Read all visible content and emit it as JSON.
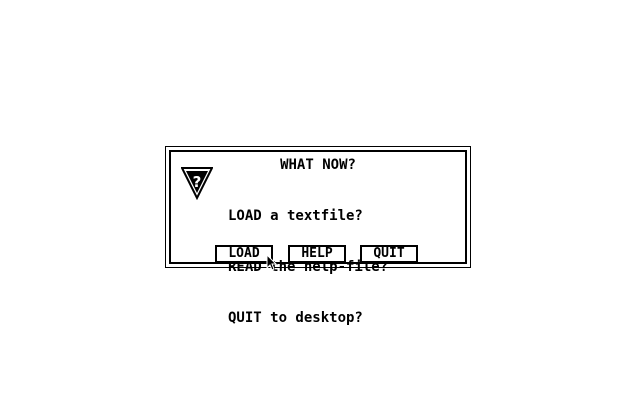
{
  "dialog": {
    "title": "WHAT NOW?",
    "lines": [
      "LOAD a textfile?",
      "READ the help-file?",
      "QUIT to desktop?"
    ],
    "icon": "question-alert-icon",
    "buttons": {
      "load": "LOAD",
      "help": "HELP",
      "quit": "QUIT"
    }
  },
  "cursor": "arrow-pointer-icon"
}
